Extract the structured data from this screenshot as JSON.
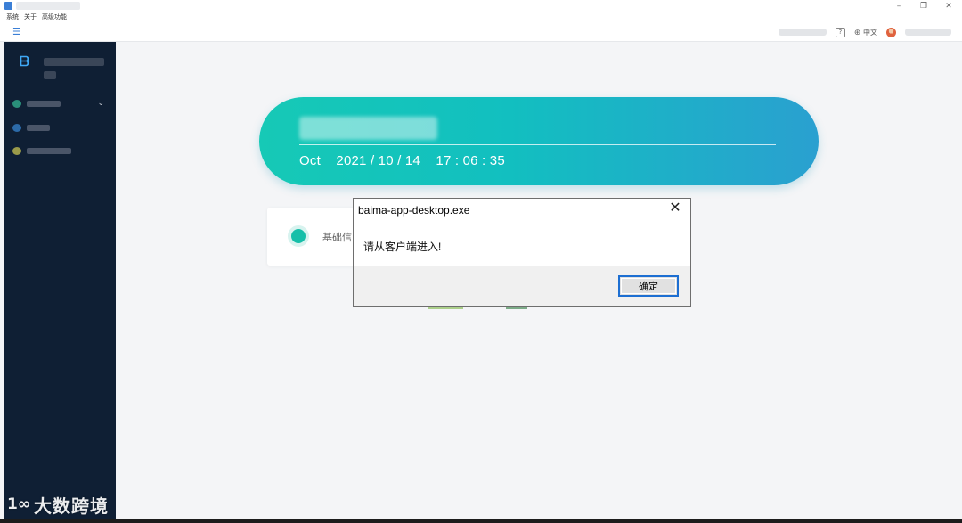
{
  "window": {
    "menu": [
      "系统",
      "关于",
      "高级功能"
    ],
    "controls": {
      "minimize": "–",
      "restore": "❐",
      "close": "✕"
    }
  },
  "toolbar": {
    "language": "中文",
    "help_icon": "help-icon",
    "globe_icon": "globe-icon",
    "avatar_icon": "avatar-icon"
  },
  "banner": {
    "datetime": "Oct    2021 / 10 / 14    17 : 06 : 35"
  },
  "card": {
    "label": "基础信"
  },
  "dialog": {
    "title": "baima-app-desktop.exe",
    "message": "请从客户端进入!",
    "ok_label": "确定",
    "close_glyph": "✕"
  },
  "watermark": {
    "logo": "1∞",
    "text": "大数跨境"
  },
  "colors": {
    "sidebar": "#0f1f34",
    "banner_start": "#16c9b6",
    "banner_end": "#2aa0d0",
    "accent": "#16bfa9",
    "dialog_button_border": "#1d6fd2"
  }
}
